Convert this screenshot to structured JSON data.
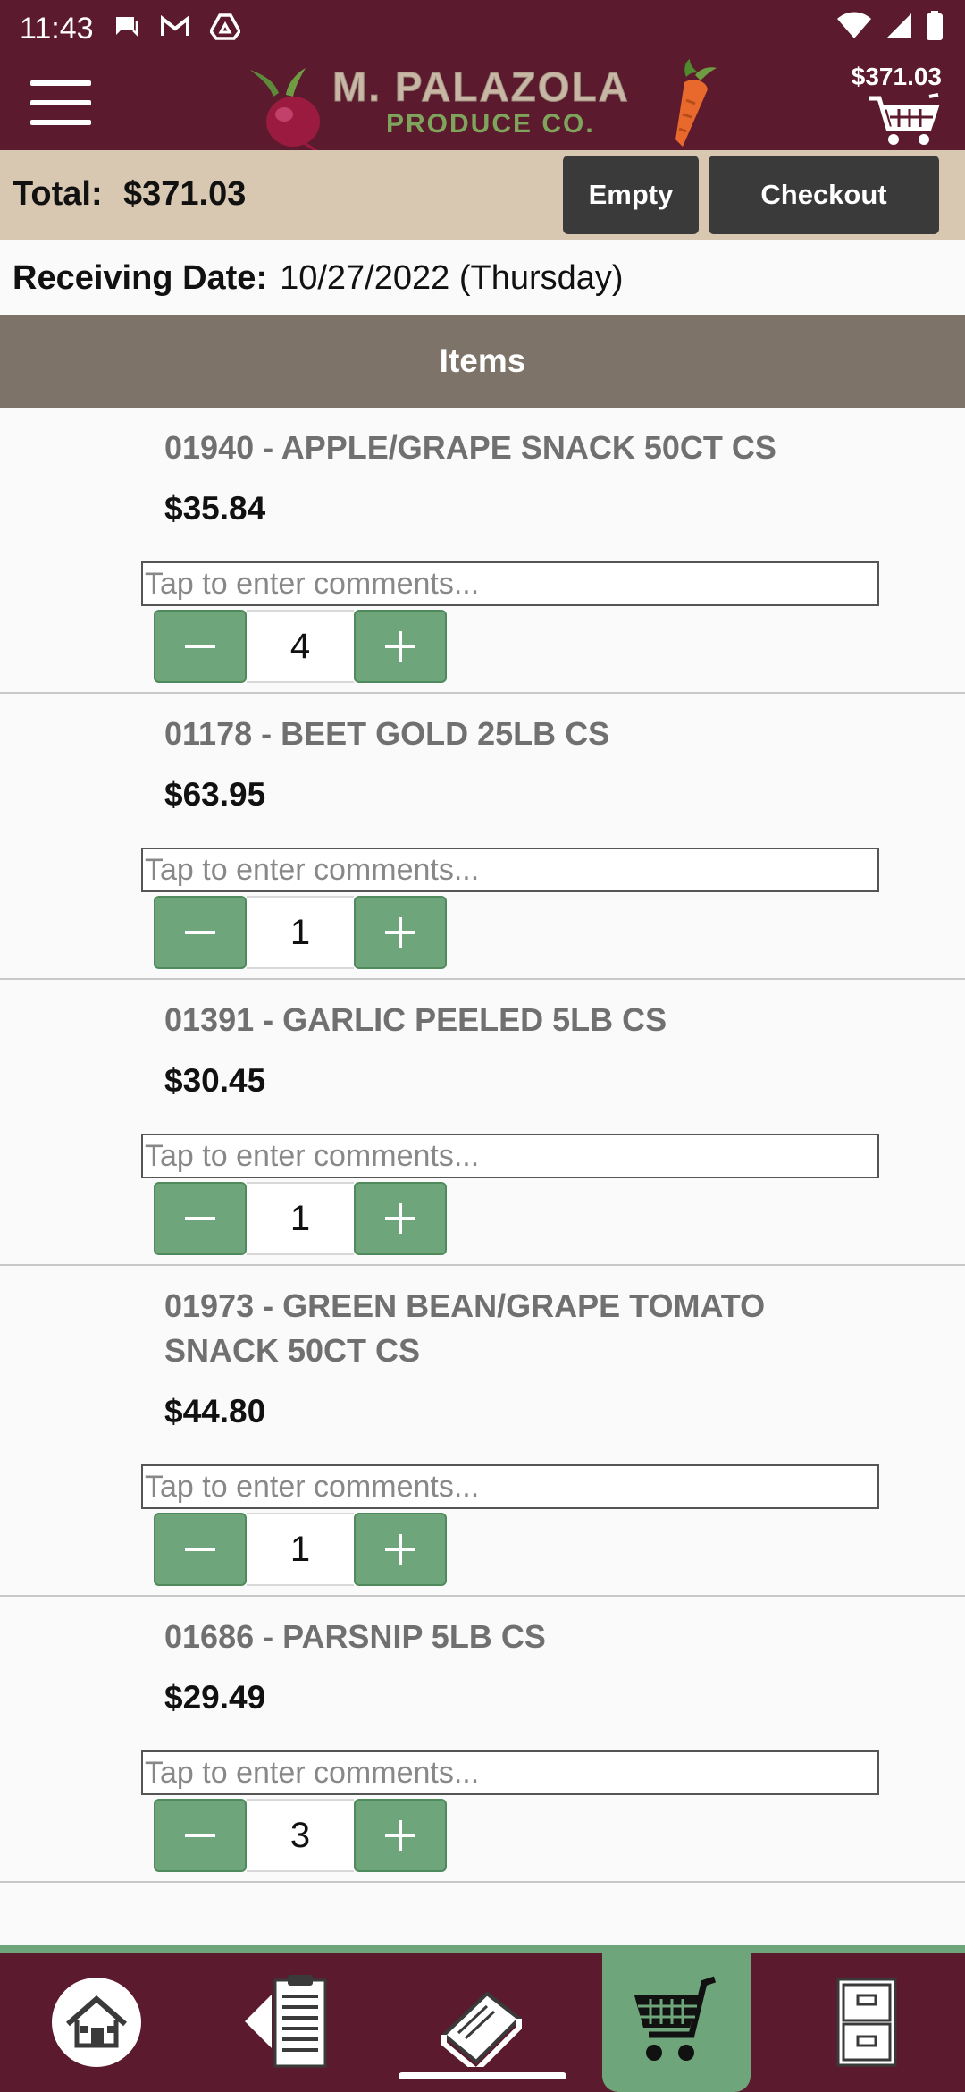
{
  "status_bar": {
    "time": "11:43"
  },
  "header": {
    "logo_title": "M. PALAZOLA",
    "logo_subtitle": "PRODUCE CO.",
    "cart_amount": "$371.03"
  },
  "total_bar": {
    "label": "Total:",
    "value": "$371.03",
    "empty_label": "Empty",
    "checkout_label": "Checkout"
  },
  "receiving": {
    "label": "Receiving Date:",
    "value": "10/27/2022 (Thursday)"
  },
  "items_header": "Items",
  "comment_placeholder": "Tap to enter comments...",
  "items": [
    {
      "name": "01940 - APPLE/GRAPE SNACK 50CT CS",
      "price": "$35.84",
      "qty": "4",
      "comment": ""
    },
    {
      "name": "01178 - BEET GOLD 25LB CS",
      "price": "$63.95",
      "qty": "1",
      "comment": ""
    },
    {
      "name": "01391 - GARLIC PEELED 5LB CS",
      "price": "$30.45",
      "qty": "1",
      "comment": ""
    },
    {
      "name": "01973 - GREEN BEAN/GRAPE TOMATO SNACK 50CT CS",
      "price": "$44.80",
      "qty": "1",
      "comment": ""
    },
    {
      "name": "01686 - PARSNIP 5LB CS",
      "price": "$29.49",
      "qty": "3",
      "comment": ""
    }
  ],
  "bottom_nav": [
    {
      "icon": "home-icon"
    },
    {
      "icon": "order-guide-icon"
    },
    {
      "icon": "catalog-book-icon"
    },
    {
      "icon": "cart-icon",
      "active": true
    },
    {
      "icon": "file-cabinet-icon"
    }
  ],
  "colors": {
    "brand": "#5b1a2d",
    "accent_green": "#6ea57b",
    "total_bar": "#d9c8b1",
    "items_header": "#7d7368"
  }
}
